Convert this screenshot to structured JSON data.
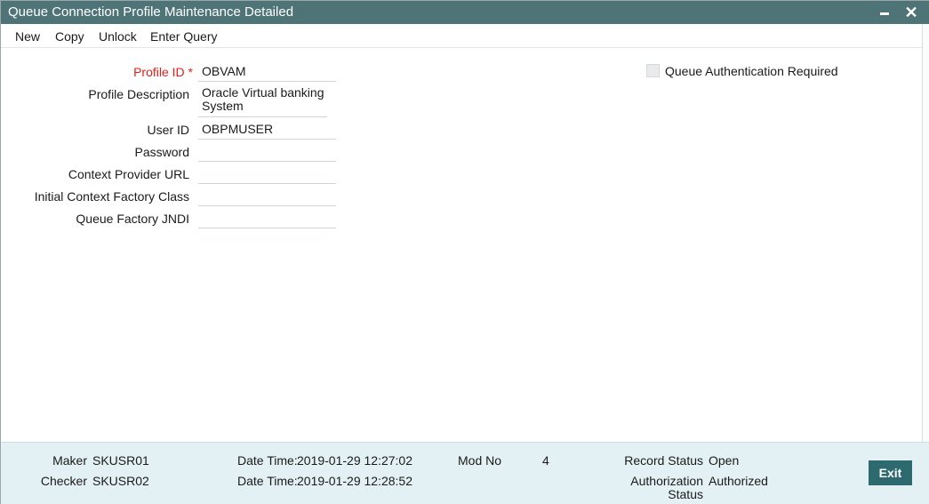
{
  "window": {
    "title": "Queue Connection Profile Maintenance Detailed",
    "minimize_icon": "minimize-icon",
    "close_icon": "close-icon",
    "close_glyph": "✕"
  },
  "toolbar": {
    "new_label": "New",
    "copy_label": "Copy",
    "unlock_label": "Unlock",
    "enter_query_label": "Enter Query"
  },
  "form": {
    "profile_id": {
      "label": "Profile ID",
      "required_mark": " *",
      "value": "OBVAM"
    },
    "profile_description": {
      "label": "Profile Description",
      "value": "Oracle Virtual banking System"
    },
    "user_id": {
      "label": "User ID",
      "value": "OBPMUSER"
    },
    "password": {
      "label": "Password",
      "value": ""
    },
    "context_provider_url": {
      "label": "Context Provider URL",
      "value": ""
    },
    "initial_context_factory_class": {
      "label": "Initial Context Factory Class",
      "value": ""
    },
    "queue_factory_jndi": {
      "label": "Queue Factory JNDI",
      "value": ""
    },
    "queue_auth_required": {
      "label": "Queue Authentication Required",
      "checked": false
    }
  },
  "footer": {
    "maker_label": "Maker",
    "maker_value": "SKUSR01",
    "checker_label": "Checker",
    "checker_value": "SKUSR02",
    "maker_datetime_label": "Date Time:",
    "maker_datetime_value": "2019-01-29 12:27:02",
    "checker_datetime_label": "Date Time:",
    "checker_datetime_value": "2019-01-29 12:28:52",
    "mod_no_label": "Mod No",
    "mod_no_value": "4",
    "record_status_label": "Record Status",
    "record_status_value": "Open",
    "authorization_status_label_line1": "Authorization",
    "authorization_status_label_line2": "Status",
    "authorization_status_value": "Authorized",
    "exit_label": "Exit"
  },
  "colors": {
    "titlebar": "#4f7478",
    "required": "#e0211c",
    "footer_bg": "#e4f1f4",
    "exit_button": "#2d6a6f"
  }
}
